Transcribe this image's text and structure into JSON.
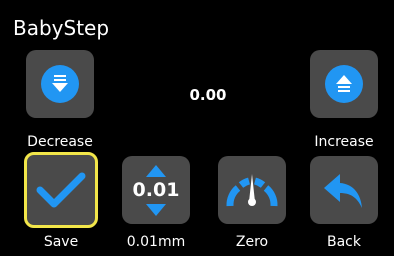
{
  "screen": {
    "title": "BabyStep"
  },
  "babystep": {
    "value": "0.00"
  },
  "buttons": {
    "decrease": {
      "label": "Decrease",
      "icon": "arrow-down-bar-icon"
    },
    "increase": {
      "label": "Increase",
      "icon": "arrow-up-bar-icon"
    },
    "save": {
      "label": "Save",
      "icon": "checkmark-icon",
      "selected": true
    },
    "step": {
      "label": "0.01mm",
      "value": "0.01",
      "icon": "up-down-arrows-icon"
    },
    "zero": {
      "label": "Zero",
      "icon": "gauge-icon"
    },
    "back": {
      "label": "Back",
      "icon": "back-arrow-icon"
    }
  },
  "colors": {
    "background": "#000000",
    "tile": "#4a4a4a",
    "accent": "#2196f3",
    "selection": "#f2e64a",
    "text": "#ffffff"
  }
}
